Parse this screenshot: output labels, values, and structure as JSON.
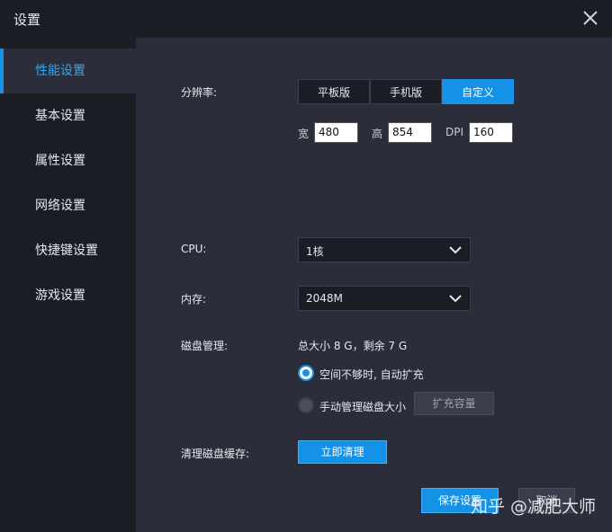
{
  "window": {
    "title": "设置"
  },
  "sidebar": {
    "items": [
      {
        "label": "性能设置",
        "active": true
      },
      {
        "label": "基本设置"
      },
      {
        "label": "属性设置"
      },
      {
        "label": "网络设置"
      },
      {
        "label": "快捷键设置"
      },
      {
        "label": "游戏设置"
      }
    ]
  },
  "resolution": {
    "label": "分辨率:",
    "options": [
      "平板版",
      "手机版",
      "自定义"
    ],
    "selected": "自定义",
    "width_label": "宽",
    "width_value": "480",
    "height_label": "高",
    "height_value": "854",
    "dpi_label": "DPI",
    "dpi_value": "160"
  },
  "cpu": {
    "label": "CPU:",
    "value": "1核"
  },
  "memory": {
    "label": "内存:",
    "value": "2048M"
  },
  "disk": {
    "label": "磁盘管理:",
    "summary": "总大小 8 G，剩余 7 G",
    "option_auto": "空间不够时, 自动扩充",
    "option_manual": "手动管理磁盘大小",
    "expand_button": "扩充容量",
    "selected": "auto"
  },
  "cache": {
    "label": "清理磁盘缓存:",
    "button": "立即清理"
  },
  "footer": {
    "save_label": "保存设置",
    "cancel_label": "取消"
  },
  "watermark": "知乎 @减肥大师",
  "colors": {
    "accent": "#1591e6",
    "sidebar_bg": "#1b1d24",
    "content_bg": "#2b2e3a"
  }
}
